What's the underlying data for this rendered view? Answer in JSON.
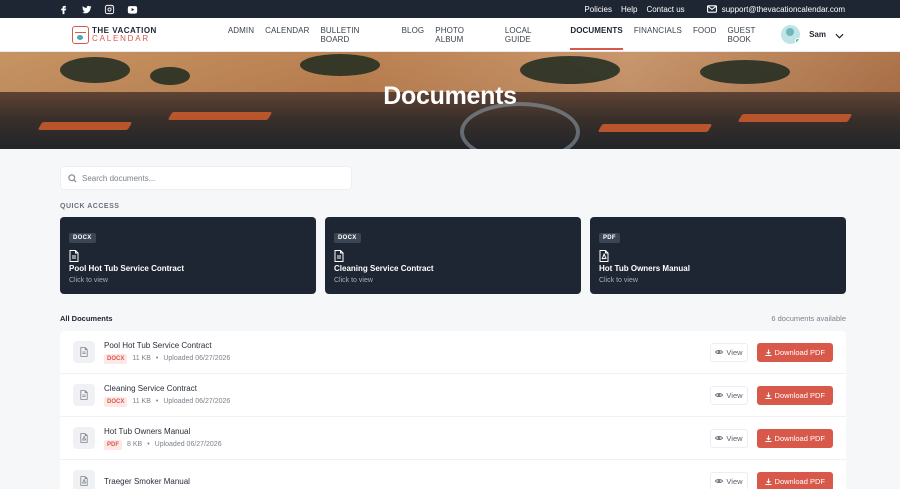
{
  "topbar": {
    "social": [
      "facebook-icon",
      "twitter-icon",
      "instagram-icon",
      "youtube-icon"
    ],
    "links": [
      "Policies",
      "Help",
      "Contact us"
    ],
    "support_email": "support@thevacationcalendar.com"
  },
  "logo": {
    "line1": "THE VACATION",
    "line2": "CALENDAR"
  },
  "nav": {
    "items": [
      "ADMIN",
      "CALENDAR",
      "BULLETIN BOARD",
      "BLOG",
      "PHOTO ALBUM",
      "LOCAL GUIDE",
      "DOCUMENTS",
      "FINANCIALS",
      "FOOD",
      "GUEST BOOK"
    ],
    "active": "DOCUMENTS"
  },
  "user": {
    "name": "Sam"
  },
  "hero": {
    "title": "Documents"
  },
  "search": {
    "placeholder": "Search documents..."
  },
  "quick_access": {
    "title": "QUICK ACCESS",
    "cards": [
      {
        "type": "DOCX",
        "title": "Pool Hot Tub Service Contract",
        "subtitle": "Click to view"
      },
      {
        "type": "DOCX",
        "title": "Cleaning Service Contract",
        "subtitle": "Click to view"
      },
      {
        "type": "PDF",
        "title": "Hot Tub Owners Manual",
        "subtitle": "Click to view"
      }
    ]
  },
  "all_documents": {
    "title": "All Documents",
    "count_text": "6 documents available",
    "view_label": "View",
    "download_label": "Download PDF",
    "rows": [
      {
        "name": "Pool Hot Tub Service Contract",
        "type": "DOCX",
        "size": "11 KB",
        "uploaded": "Uploaded 06/27/2026"
      },
      {
        "name": "Cleaning Service Contract",
        "type": "DOCX",
        "size": "11 KB",
        "uploaded": "Uploaded 06/27/2026"
      },
      {
        "name": "Hot Tub Owners Manual",
        "type": "PDF",
        "size": "8 KB",
        "uploaded": "Uploaded 06/27/2026"
      },
      {
        "name": "Traeger Smoker Manual",
        "type": "PDF",
        "size": "",
        "uploaded": ""
      }
    ]
  },
  "colors": {
    "accent": "#d8594a",
    "dark": "#1f2633"
  }
}
